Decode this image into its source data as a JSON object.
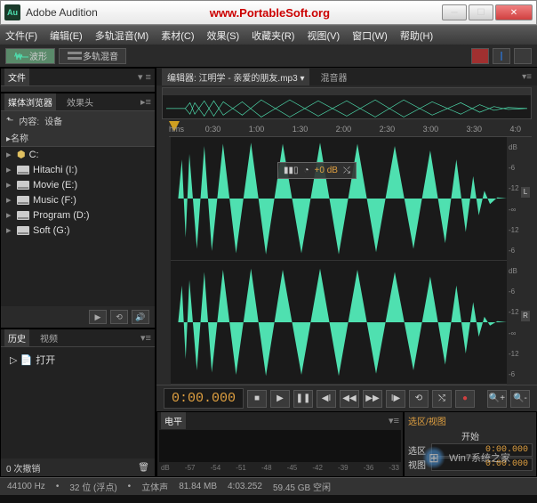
{
  "titlebar": {
    "app": "Adobe Audition",
    "url": "www.PortableSoft.org"
  },
  "menu": [
    "文件(F)",
    "编辑(E)",
    "多轨混音(M)",
    "素材(C)",
    "效果(S)",
    "收藏夹(R)",
    "视图(V)",
    "窗口(W)",
    "帮助(H)"
  ],
  "toolbar": {
    "waveform": "波形",
    "multitrack": "多轨混音"
  },
  "files_panel": {
    "tab": "文件"
  },
  "browser_panel": {
    "tab1": "媒体浏览器",
    "tab2": "效果头",
    "content_label": "内容:",
    "content_value": "设备",
    "name_col": "名称",
    "drives": [
      "C:",
      "Hitachi (I:)",
      "Movie (E:)",
      "Music (F:)",
      "Program (D:)",
      "Soft (G:)"
    ]
  },
  "history_panel": {
    "tab1": "历史",
    "tab2": "视频",
    "item": "打开",
    "undo": "0 次撤销"
  },
  "editor": {
    "tab_prefix": "编辑器:",
    "filename": "江明学 - 亲爱的朋友.mp3",
    "mixer": "混音器",
    "ruler_unit": "hms",
    "ruler": [
      "0:30",
      "1:00",
      "1:30",
      "2:00",
      "2:30",
      "3:00",
      "3:30",
      "4:0"
    ],
    "hud_value": "+0 dB",
    "db": [
      "dB",
      "-6",
      "-12",
      "-∞",
      "-12",
      "-6"
    ],
    "ch_l": "L",
    "ch_r": "R",
    "timecode": "0:00.000"
  },
  "level": {
    "tab": "电平",
    "scale": [
      "dB",
      "-57",
      "-54",
      "-51",
      "-48",
      "-45",
      "-42",
      "-39",
      "-36",
      "-33"
    ]
  },
  "selection": {
    "tab": "选区/视图",
    "col_start": "开始",
    "row1_label": "选区",
    "row1_val": "0:00.000",
    "row2_label": "视图",
    "row2_val": "0:00.000"
  },
  "status": {
    "rate": "44100 Hz",
    "depth": "32 位 (浮点)",
    "channels": "立体声",
    "size": "81.84 MB",
    "time": "4:03.252",
    "free": "59.45 GB 空闲"
  },
  "watermark": "Win7系统之家"
}
